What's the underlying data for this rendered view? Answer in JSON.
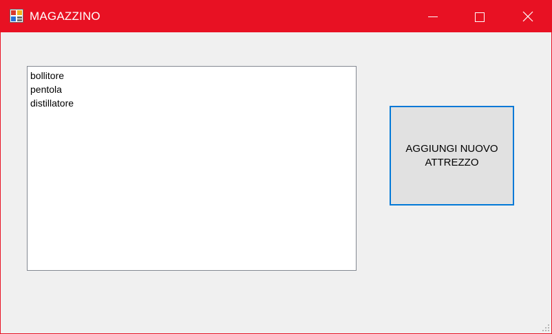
{
  "window": {
    "title": "MAGAZZINO",
    "title_bar_color": "#e81123",
    "icons": {
      "app": "app-window-icon",
      "minimize": "minimize-icon",
      "maximize": "maximize-icon",
      "close": "close-icon"
    }
  },
  "main": {
    "list": {
      "items": [
        "bollitore",
        "pentola",
        "distillatore"
      ]
    },
    "add_button": {
      "label": "AGGIUNGI NUOVO ATTREZZO",
      "focus_border_color": "#0078d7"
    }
  }
}
